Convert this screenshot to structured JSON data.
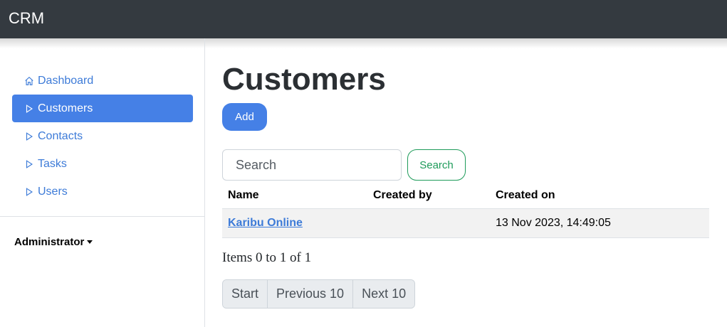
{
  "app": {
    "brand": "CRM"
  },
  "sidebar": {
    "items": [
      {
        "label": "Dashboard",
        "icon": "home-icon",
        "active": false
      },
      {
        "label": "Customers",
        "icon": "play-outline-icon",
        "active": true
      },
      {
        "label": "Contacts",
        "icon": "play-outline-icon",
        "active": false
      },
      {
        "label": "Tasks",
        "icon": "play-outline-icon",
        "active": false
      },
      {
        "label": "Users",
        "icon": "play-outline-icon",
        "active": false
      }
    ],
    "user": "Administrator"
  },
  "main": {
    "title": "Customers",
    "add_label": "Add",
    "search": {
      "placeholder": "Search",
      "value": "",
      "button": "Search"
    },
    "table": {
      "columns": [
        "Name",
        "Created by",
        "Created on"
      ],
      "rows": [
        {
          "name": "Karibu Online",
          "created_by": "",
          "created_on": "13 Nov 2023, 14:49:05"
        }
      ]
    },
    "items_text": "Items 0 to 1 of 1",
    "pagination": [
      "Start",
      "Previous 10",
      "Next 10"
    ]
  },
  "colors": {
    "topbar": "#343a40",
    "primary": "#4580e6",
    "link": "#3d7bd8",
    "success": "#1e9b5a"
  }
}
